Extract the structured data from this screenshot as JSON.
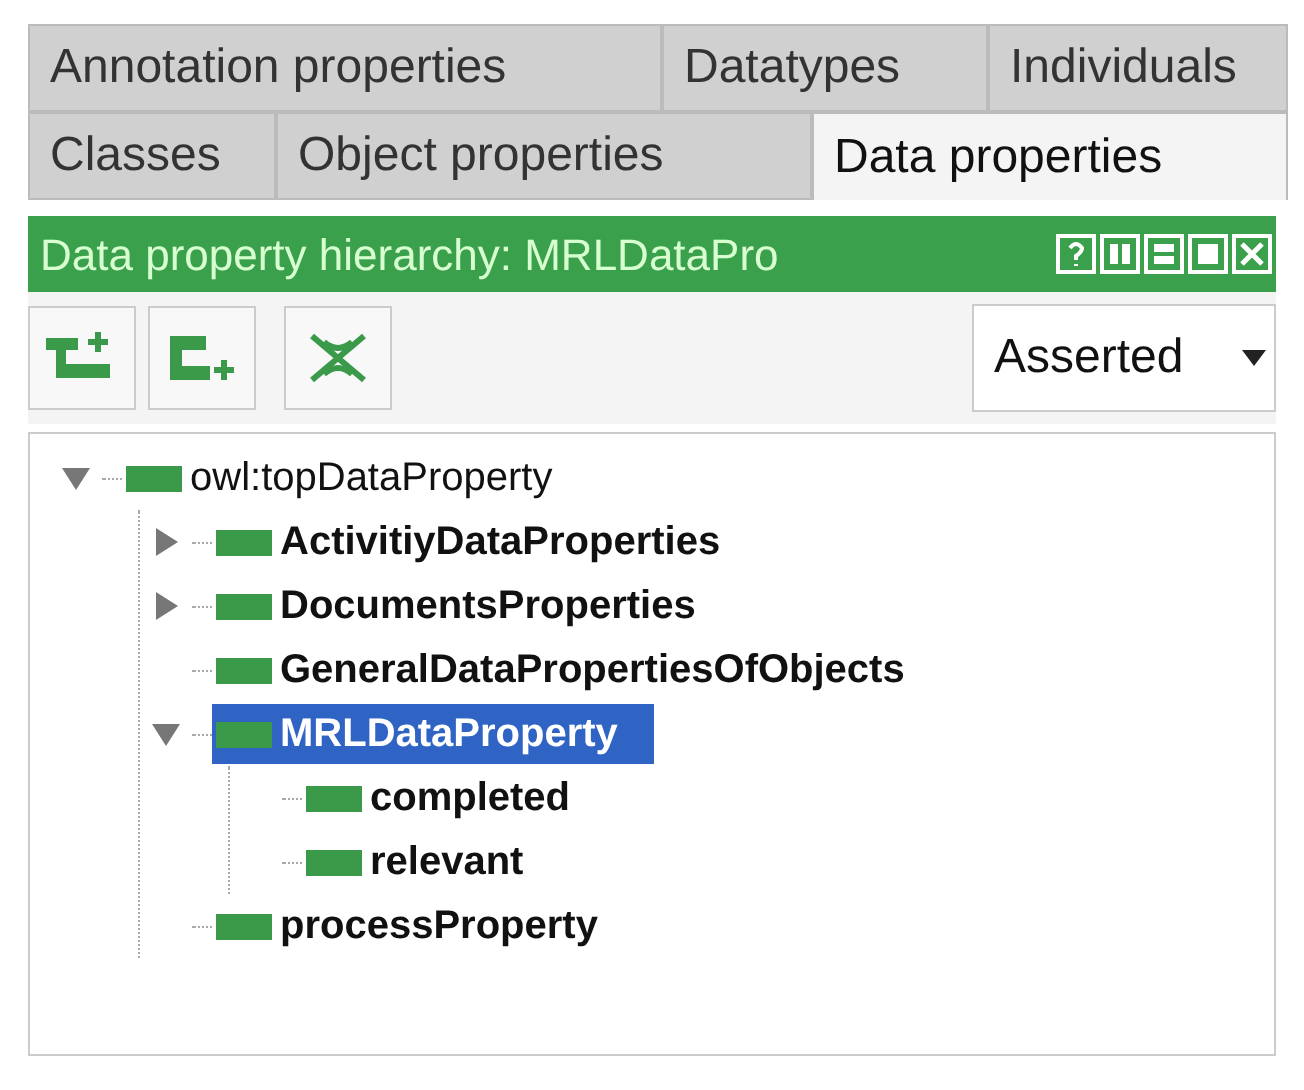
{
  "tab_rows": [
    [
      {
        "label": "Annotation properties",
        "selected": false
      },
      {
        "label": "Datatypes",
        "selected": false
      },
      {
        "label": "Individuals",
        "selected": false
      }
    ],
    [
      {
        "label": "Classes",
        "selected": false
      },
      {
        "label": "Object properties",
        "selected": false
      },
      {
        "label": "Data properties",
        "selected": true
      }
    ]
  ],
  "view": {
    "title": "Data property hierarchy: MRLDataPro"
  },
  "toolbar": {
    "dropdown": {
      "value": "Asserted"
    }
  },
  "tree": [
    {
      "label": "owl:topDataProperty",
      "kind": "root",
      "selected": false,
      "expanded": true,
      "children": [
        {
          "label": "ActivitiyDataProperties",
          "kind": "property",
          "selected": false,
          "expanded": false
        },
        {
          "label": "DocumentsProperties",
          "kind": "property",
          "selected": false,
          "expanded": false
        },
        {
          "label": "GeneralDataPropertiesOfObjects",
          "kind": "property",
          "selected": false
        },
        {
          "label": "MRLDataProperty",
          "kind": "property",
          "selected": true,
          "expanded": true,
          "children": [
            {
              "label": "completed",
              "kind": "property",
              "selected": false
            },
            {
              "label": "relevant",
              "kind": "property",
              "selected": false
            }
          ]
        },
        {
          "label": "processProperty",
          "kind": "property",
          "selected": false
        }
      ]
    }
  ]
}
